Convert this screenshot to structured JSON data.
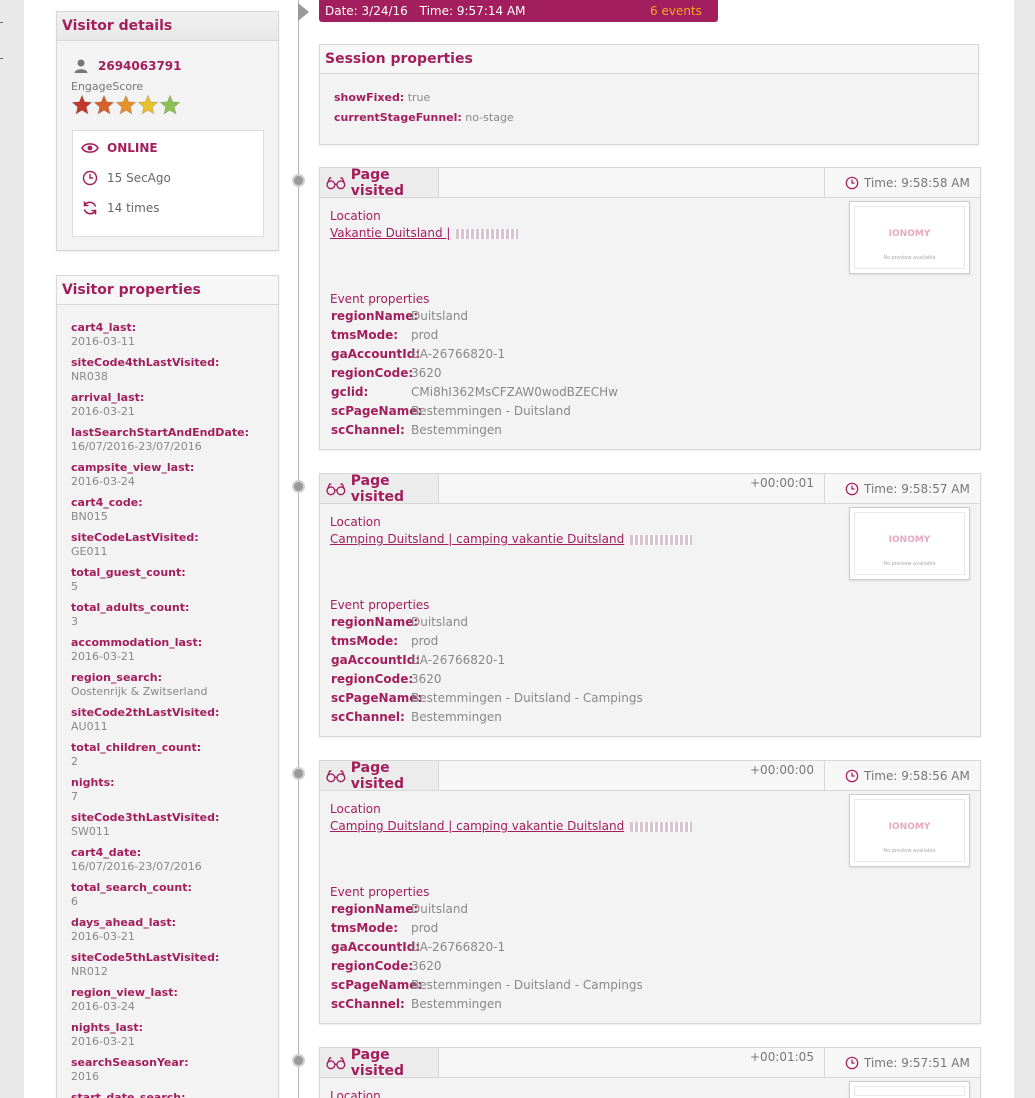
{
  "visitor": {
    "title": "Visitor details",
    "id": "2694063791",
    "engage_label": "EngageScore",
    "stars": [
      "#c0392b",
      "#d4622a",
      "#e6912b",
      "#e8c12e",
      "#8cc152"
    ],
    "status": "ONLINE",
    "last_seen": "15 SecAgo",
    "visits": "14 times"
  },
  "properties": {
    "title": "Visitor properties",
    "items": [
      {
        "k": "cart4_last:",
        "v": "2016-03-11"
      },
      {
        "k": "siteCode4thLastVisited:",
        "v": "NR038"
      },
      {
        "k": "arrival_last:",
        "v": "2016-03-21"
      },
      {
        "k": "lastSearchStartAndEndDate:",
        "v": "16/07/2016-23/07/2016"
      },
      {
        "k": "campsite_view_last:",
        "v": "2016-03-24"
      },
      {
        "k": "cart4_code:",
        "v": "BN015"
      },
      {
        "k": "siteCodeLastVisited:",
        "v": "GE011"
      },
      {
        "k": "total_guest_count:",
        "v": "5"
      },
      {
        "k": "total_adults_count:",
        "v": "3"
      },
      {
        "k": "accommodation_last:",
        "v": "2016-03-21"
      },
      {
        "k": "region_search:",
        "v": "Oostenrijk & Zwitserland"
      },
      {
        "k": "siteCode2thLastVisited:",
        "v": "AU011"
      },
      {
        "k": "total_children_count:",
        "v": "2"
      },
      {
        "k": "nights:",
        "v": "7"
      },
      {
        "k": "siteCode3thLastVisited:",
        "v": "SW011"
      },
      {
        "k": "cart4_date:",
        "v": "16/07/2016-23/07/2016"
      },
      {
        "k": "total_search_count:",
        "v": "6"
      },
      {
        "k": "days_ahead_last:",
        "v": "2016-03-21"
      },
      {
        "k": "siteCode5thLastVisited:",
        "v": "NR012"
      },
      {
        "k": "region_view_last:",
        "v": "2016-03-24"
      },
      {
        "k": "nights_last:",
        "v": "2016-03-21"
      },
      {
        "k": "searchSeasonYear:",
        "v": "2016"
      },
      {
        "k": "start_date_search:",
        "v": ""
      }
    ]
  },
  "session_bar": {
    "date": "Date: 3/24/16",
    "time": "Time: 9:57:14 AM",
    "events": "6 events"
  },
  "session": {
    "title": "Session properties",
    "items": [
      {
        "k": "showFixed:",
        "v": "true"
      },
      {
        "k": "currentStageFunnel:",
        "v": "no-stage"
      }
    ]
  },
  "events": [
    {
      "title": "Page visited",
      "offset": "",
      "time": "Time: 9:58:58 AM",
      "location_label": "Location",
      "location": "Vakantie Duitsland |",
      "preview_logo": "IONOMY",
      "preview_text": "No preview available",
      "props_label": "Event properties",
      "props": [
        {
          "k": "regionName:",
          "v": "Duitsland"
        },
        {
          "k": "tmsMode:",
          "v": "prod"
        },
        {
          "k": "gaAccountId:",
          "v": "UA-26766820-1"
        },
        {
          "k": "regionCode:",
          "v": "3620"
        },
        {
          "k": "gclid:",
          "v": "CMi8hI362MsCFZAW0wodBZECHw"
        },
        {
          "k": "scPageName:",
          "v": "Bestemmingen - Duitsland"
        },
        {
          "k": "scChannel:",
          "v": "Bestemmingen"
        }
      ]
    },
    {
      "title": "Page visited",
      "offset": "+00:00:01",
      "time": "Time: 9:58:57 AM",
      "location_label": "Location",
      "location": "Camping Duitsland | camping vakantie Duitsland",
      "preview_logo": "IONOMY",
      "preview_text": "No preview available",
      "props_label": "Event properties",
      "props": [
        {
          "k": "regionName:",
          "v": "Duitsland"
        },
        {
          "k": "tmsMode:",
          "v": "prod"
        },
        {
          "k": "gaAccountId:",
          "v": "UA-26766820-1"
        },
        {
          "k": "regionCode:",
          "v": "3620"
        },
        {
          "k": "scPageName:",
          "v": "Bestemmingen - Duitsland - Campings"
        },
        {
          "k": "scChannel:",
          "v": "Bestemmingen"
        }
      ]
    },
    {
      "title": "Page visited",
      "offset": "+00:00:00",
      "time": "Time: 9:58:56 AM",
      "location_label": "Location",
      "location": "Camping Duitsland | camping vakantie Duitsland",
      "preview_logo": "IONOMY",
      "preview_text": "No preview available",
      "props_label": "Event properties",
      "props": [
        {
          "k": "regionName:",
          "v": "Duitsland"
        },
        {
          "k": "tmsMode:",
          "v": "prod"
        },
        {
          "k": "gaAccountId:",
          "v": "UA-26766820-1"
        },
        {
          "k": "regionCode:",
          "v": "3620"
        },
        {
          "k": "scPageName:",
          "v": "Bestemmingen - Duitsland - Campings"
        },
        {
          "k": "scChannel:",
          "v": "Bestemmingen"
        }
      ]
    },
    {
      "title": "Page visited",
      "offset": "+00:01:05",
      "time": "Time: 9:57:51 AM",
      "location_label": "Location",
      "location": "",
      "preview_logo": "",
      "preview_text": "",
      "props_label": "",
      "props": []
    }
  ]
}
